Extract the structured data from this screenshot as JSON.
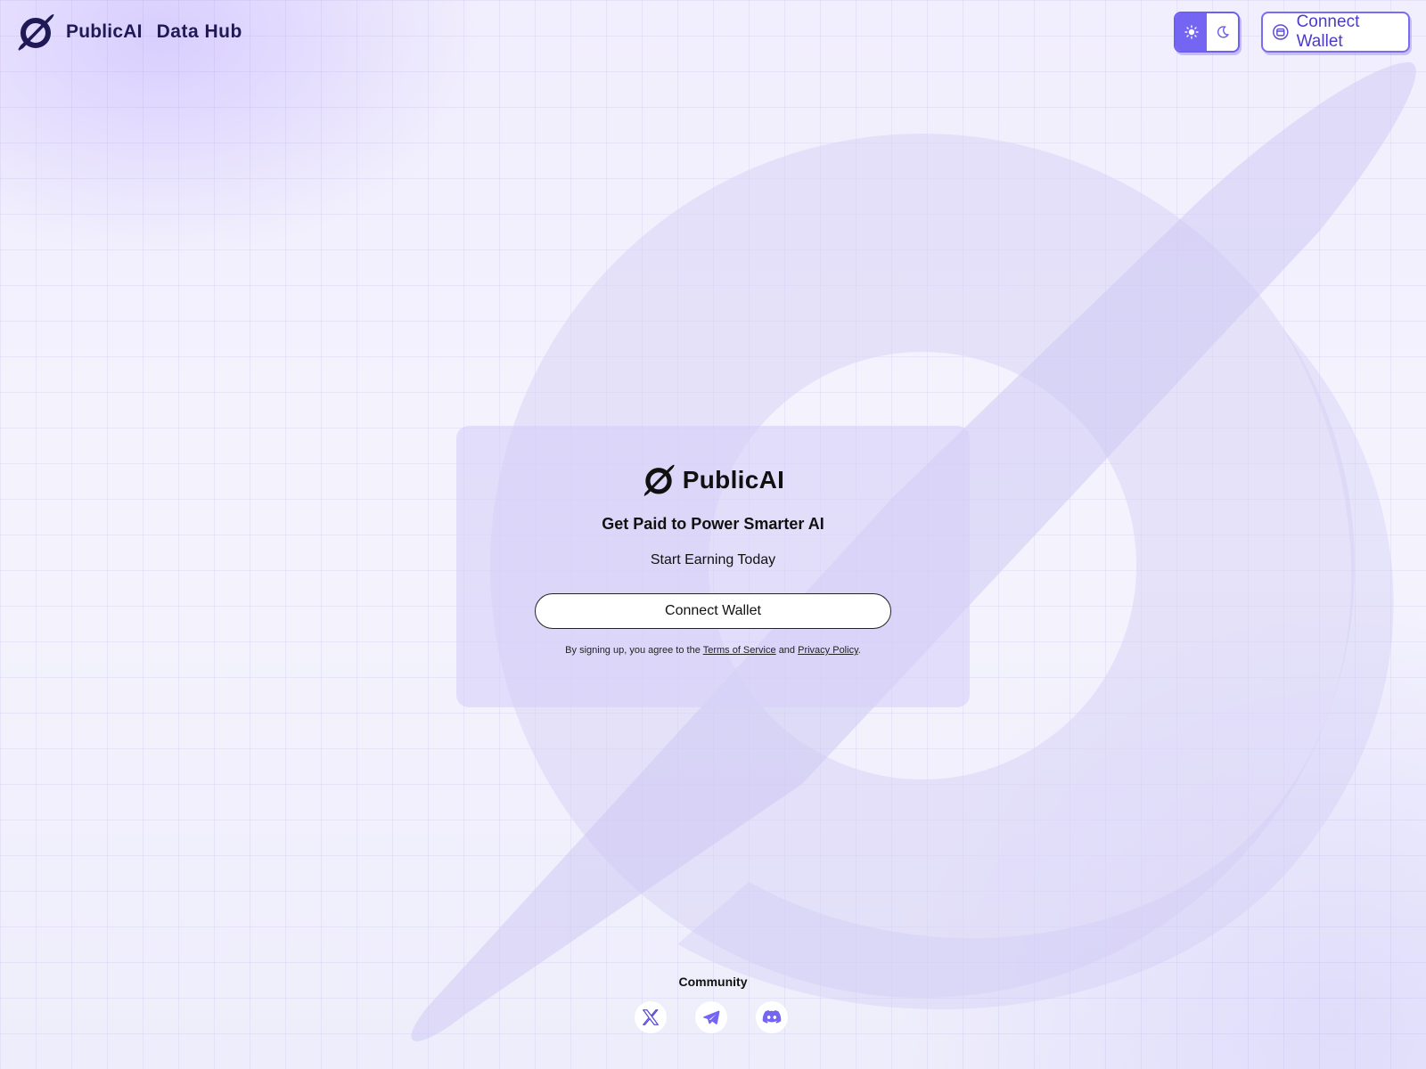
{
  "header": {
    "brand_name": "PublicAI",
    "brand_sub": "Data Hub",
    "connect_label": "Connect Wallet",
    "theme_toggle": {
      "active": "light",
      "light_icon": "sun-icon",
      "dark_icon": "moon-icon"
    }
  },
  "card": {
    "brand_name": "PublicAI",
    "title": "Get Paid to Power Smarter AI",
    "subtitle": "Start Earning Today",
    "connect_label": "Connect Wallet",
    "terms": {
      "prefix": "By signing up, you agree to the",
      "terms_link": "Terms of Service",
      "and": "and",
      "privacy_link": "Privacy Policy",
      "suffix": "."
    }
  },
  "footer": {
    "community_label": "Community",
    "socials": [
      {
        "name": "x-icon"
      },
      {
        "name": "telegram-icon"
      },
      {
        "name": "discord-icon"
      }
    ]
  },
  "colors": {
    "brand_dark": "#1f1a55",
    "accent": "#7565f3",
    "card_bg": "#d6d0f8",
    "background": "#f2f1fc"
  }
}
